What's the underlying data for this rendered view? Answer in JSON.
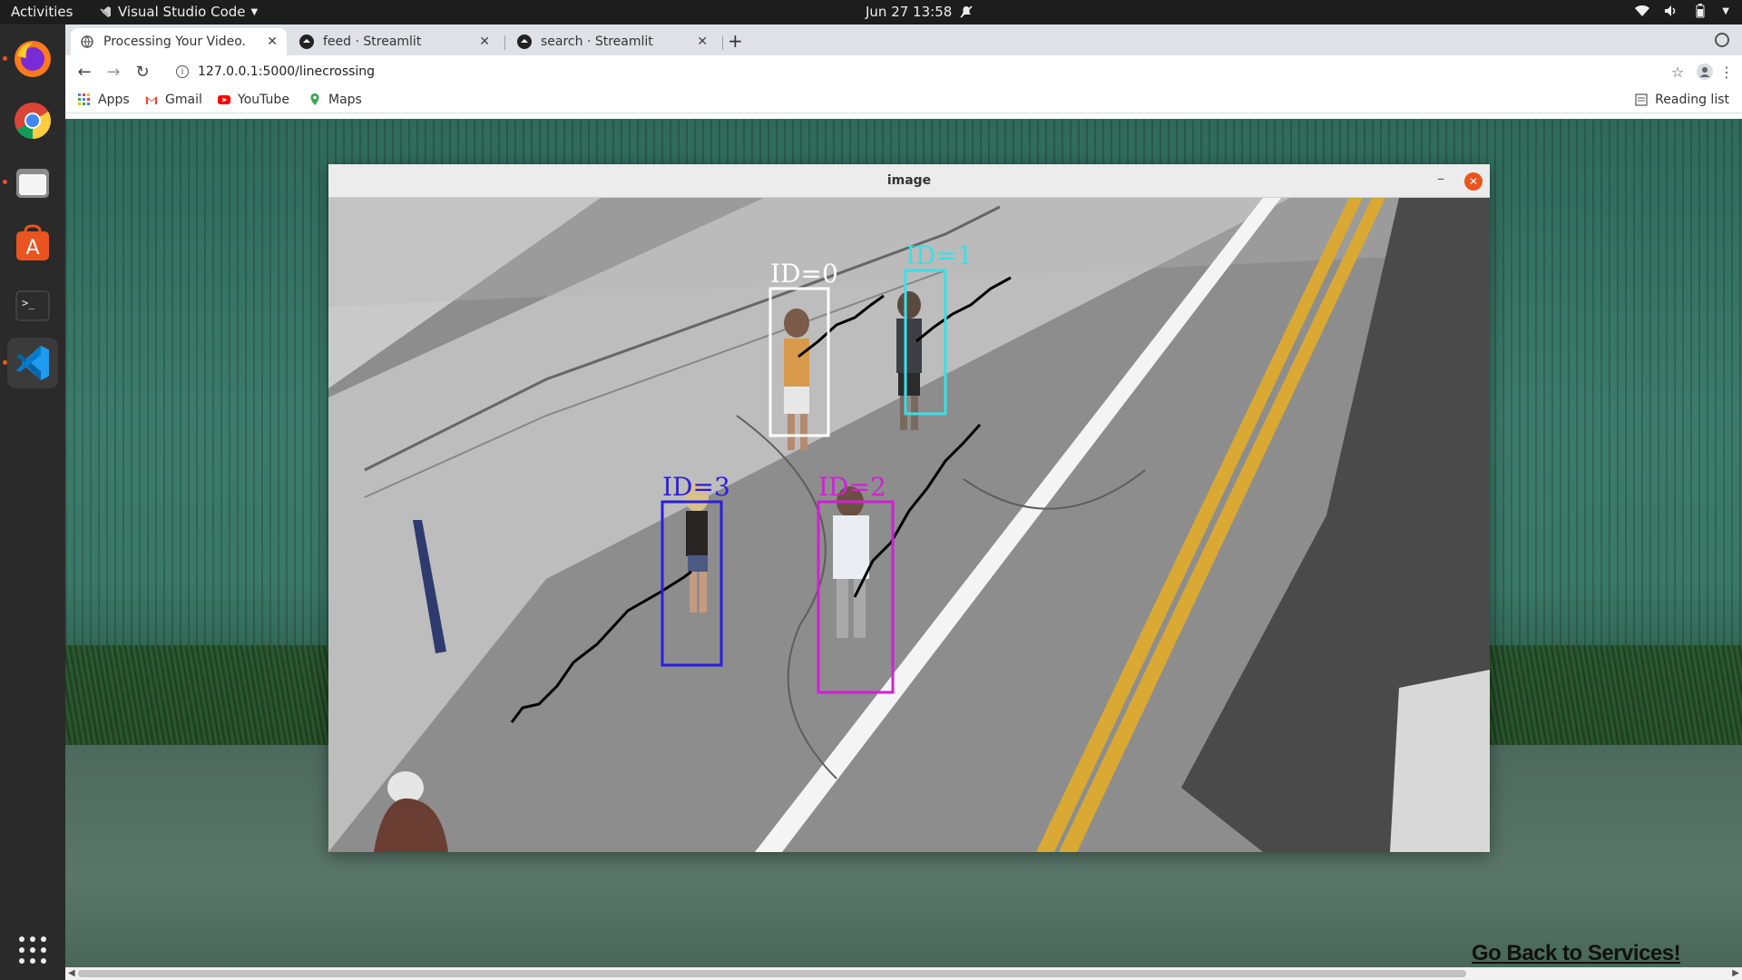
{
  "topbar": {
    "activities": "Activities",
    "app_name": "Visual Studio Code",
    "clock": "Jun 27  13:58"
  },
  "dock": {
    "items": [
      "firefox",
      "chrome",
      "files",
      "software",
      "terminal",
      "vscode"
    ]
  },
  "browser": {
    "tabs": [
      {
        "title": "Processing Your Video.",
        "active": true
      },
      {
        "title": "feed · Streamlit",
        "active": false
      },
      {
        "title": "search · Streamlit",
        "active": false
      }
    ],
    "url": "127.0.0.1:5000/linecrossing",
    "bookmarks": [
      "Apps",
      "Gmail",
      "YouTube",
      "Maps"
    ],
    "reading_list": "Reading list"
  },
  "cv_window": {
    "title": "image",
    "detections": [
      {
        "label": "ID=0",
        "color": "#ffffff"
      },
      {
        "label": "ID=1",
        "color": "#38e0e8"
      },
      {
        "label": "ID=2",
        "color": "#d21fd6"
      },
      {
        "label": "ID=3",
        "color": "#2a1ee0"
      }
    ]
  },
  "page": {
    "back_link": "Go Back to Services!"
  },
  "colors": {
    "ubuntu_orange": "#e95420",
    "topbar_bg": "#1d1d1d"
  }
}
